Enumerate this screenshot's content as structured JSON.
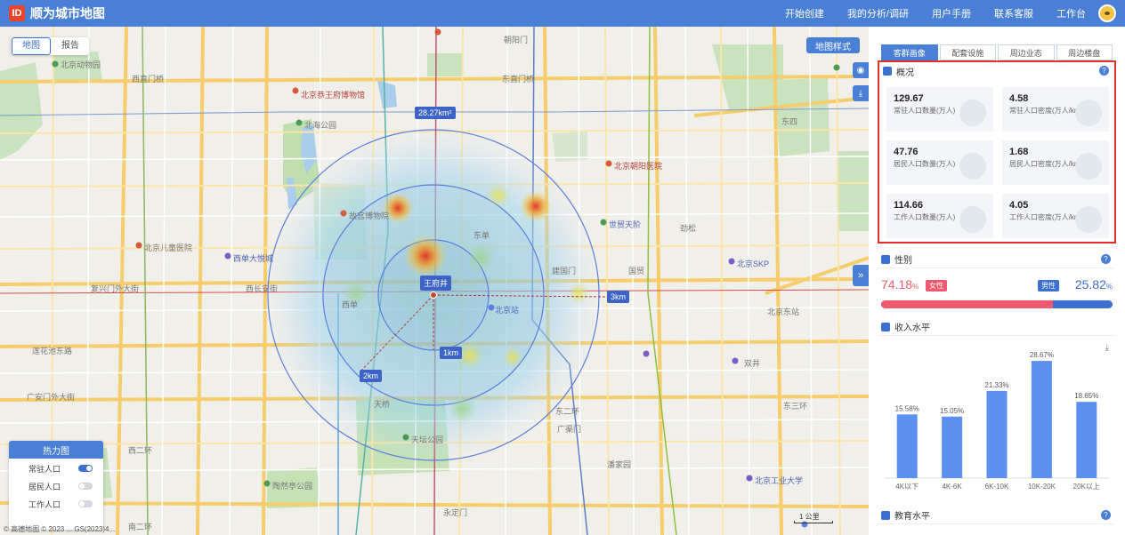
{
  "header": {
    "logo": "ID",
    "title": "顺为城市地图",
    "nav": [
      "开始创建",
      "我的分析/调研",
      "用户手册",
      "联系客服",
      "工作台"
    ]
  },
  "map": {
    "view_tabs": [
      "地图",
      "报告"
    ],
    "style_button": "地图样式",
    "collapse_icon": "»",
    "ring_labels": {
      "area": "28.27km²",
      "center": "王府井",
      "r1": "1km",
      "r2": "2km",
      "r3": "3km"
    },
    "layer_panel": {
      "title": "热力图",
      "layers": [
        {
          "label": "常驻人口",
          "on": true
        },
        {
          "label": "居民人口",
          "on": false
        },
        {
          "label": "工作人口",
          "on": false
        }
      ]
    },
    "scale": "1 公里",
    "copyright": "© 高德地图 © 2023 ... GS(2023)4...",
    "place_labels": {
      "beijing_zoo": "北京动物园",
      "xizhimen": "西直门桥",
      "beihai": "北海公园",
      "gugong": "故宫博物院",
      "gongwangfu": "北京恭王府博物馆",
      "chaoyang_hospital": "北京朝阳医院",
      "shimao": "世贸天阶",
      "children_hospital": "北京儿童医院",
      "xidan": "西单大悦城",
      "skp": "北京SKP",
      "beijing_station": "北京站",
      "wangfujing_label": "王府井",
      "tiantan": "天坛公园",
      "taoranting": "陶然亭公园",
      "guomao": "国贸",
      "dongdan": "东单",
      "jianguomen": "建国门",
      "xichang": "西单",
      "fuxingmen": "复兴门外大街",
      "changan": "西长安街",
      "guanganmen": "广安门外大街",
      "lianhuachi": "莲花池东路",
      "xierhuan": "西二环",
      "dongerhuan": "东二环",
      "sanhuan": "东三环",
      "erhuan_south": "南二环",
      "dongzhimen": "东直门桥",
      "dongsi": "东四",
      "beijing_east": "北京东站",
      "tianqiao": "天桥",
      "guangqumen": "广渠门",
      "jinsong": "劲松",
      "panjiayuan": "潘家园",
      "shuangjing": "双井",
      "huoying": "北京工业大学",
      "yongdingmen": "永定门",
      "chaoyangmen": "朝阳门"
    }
  },
  "panel": {
    "tabs": [
      "客群画像",
      "配套设施",
      "周边业态",
      "周边楼盘"
    ],
    "overview": {
      "title": "概况",
      "items": [
        {
          "value": "129.67",
          "label": "常驻人口数量(万人)"
        },
        {
          "value": "4.58",
          "label": "常驻人口密度(万人/km²)"
        },
        {
          "value": "47.76",
          "label": "居民人口数量(万人)"
        },
        {
          "value": "1.68",
          "label": "居民人口密度(万人/km²)"
        },
        {
          "value": "114.66",
          "label": "工作人口数量(万人)"
        },
        {
          "value": "4.05",
          "label": "工作人口密度(万人/km²)"
        }
      ]
    },
    "gender": {
      "title": "性别",
      "female_pct": 74.18,
      "female_text": "74.18",
      "male_text": "25.82",
      "unit": "%",
      "female_label": "女性",
      "male_label": "男性"
    },
    "income": {
      "title": "收入水平"
    },
    "education": {
      "title": "教育水平"
    }
  },
  "chart_data": {
    "type": "bar",
    "categories": [
      "4K以下",
      "4K-6K",
      "6K-10K",
      "10K-20K",
      "20K以上"
    ],
    "values": [
      15.58,
      15.05,
      21.33,
      28.67,
      18.65
    ],
    "value_labels": [
      "15.58%",
      "15.05%",
      "21.33%",
      "28.67%",
      "18.65%"
    ],
    "ylim": [
      0,
      30
    ],
    "grid": false,
    "bar_color": "#5b8ff0",
    "title": "收入水平"
  }
}
